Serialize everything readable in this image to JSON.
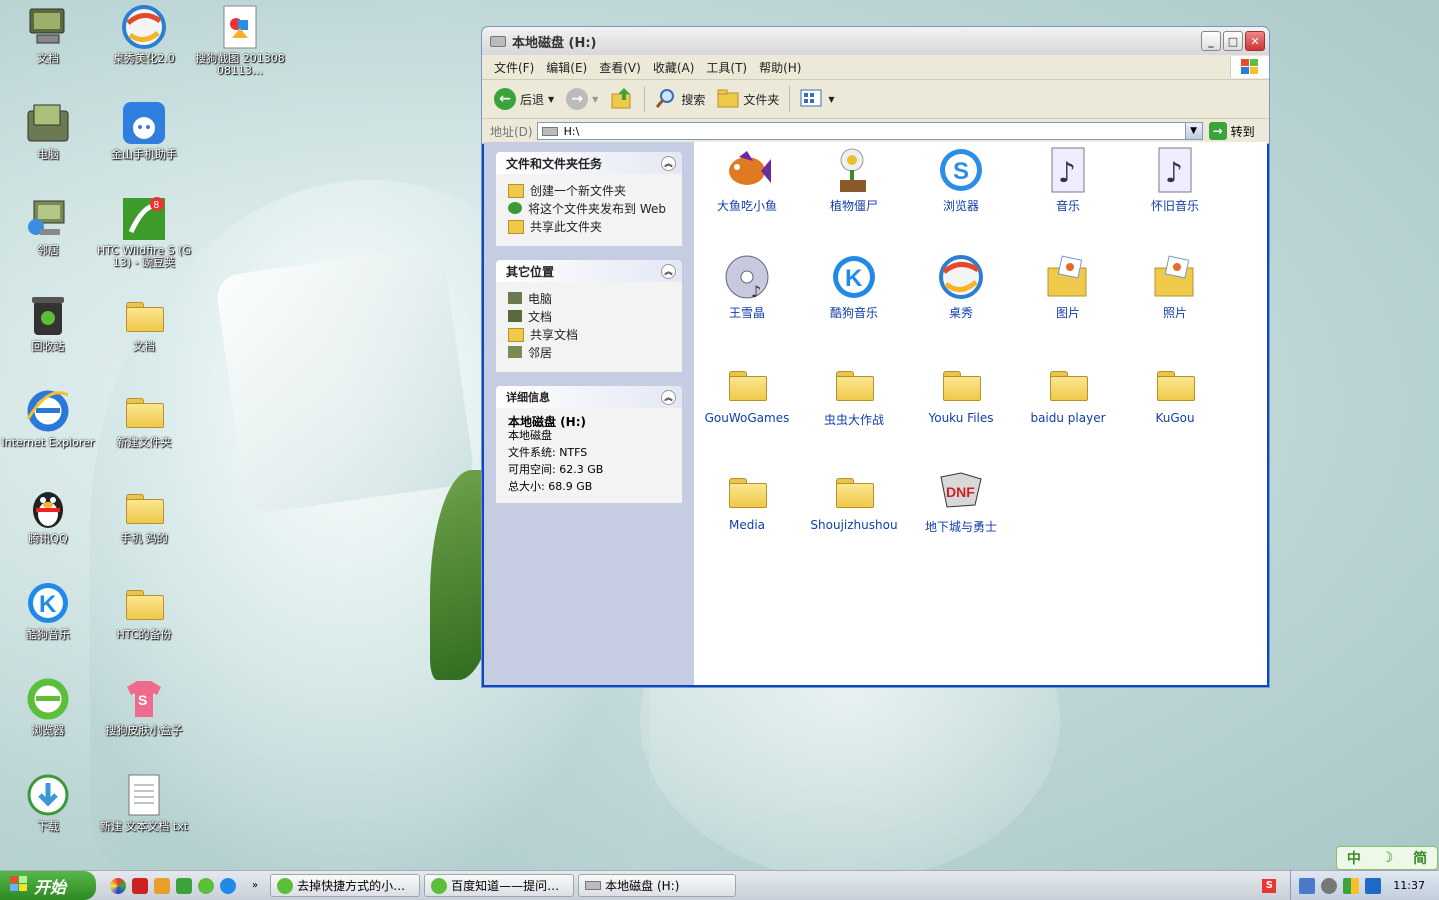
{
  "desktop": {
    "icons": [
      {
        "label": "文档",
        "icon": "computer-icon"
      },
      {
        "label": "桌秀美化2.0",
        "icon": "browser-swirl-icon"
      },
      {
        "label": "搜狗截图 20130808113…",
        "icon": "image-file-icon"
      },
      {
        "label": "电脑",
        "icon": "computer-folder-icon"
      },
      {
        "label": "金山手机助手",
        "icon": "android-helper-icon"
      },
      {
        "label": "邻居",
        "icon": "network-icon"
      },
      {
        "label": "HTC Wildfire S (G13) - 豌豆荚",
        "icon": "wandoujia-icon"
      },
      {
        "label": "回收站",
        "icon": "recycle-bin-icon"
      },
      {
        "label": "文档",
        "icon": "folder-icon"
      },
      {
        "label": "Internet Explorer",
        "icon": "ie-icon"
      },
      {
        "label": "新建文件夹",
        "icon": "folder-icon"
      },
      {
        "label": "腾讯QQ",
        "icon": "qq-icon"
      },
      {
        "label": "手机 妈的",
        "icon": "folder-icon"
      },
      {
        "label": "酷狗音乐",
        "icon": "kugou-icon"
      },
      {
        "label": "HTC的备份",
        "icon": "folder-icon"
      },
      {
        "label": "浏览器",
        "icon": "browser-e-icon"
      },
      {
        "label": "搜狗皮肤小盒子",
        "icon": "sogou-skin-icon"
      },
      {
        "label": "下载",
        "icon": "download-icon"
      },
      {
        "label": "新建 文本文档 txt",
        "icon": "text-document-icon"
      }
    ]
  },
  "window": {
    "title": "本地磁盘 (H:)",
    "menu": [
      "文件(F)",
      "编辑(E)",
      "查看(V)",
      "收藏(A)",
      "工具(T)",
      "帮助(H)"
    ],
    "toolbar": {
      "back": "后退",
      "search": "搜索",
      "folders": "文件夹"
    },
    "address": {
      "label": "地址(D)",
      "value": "H:\\",
      "go": "转到"
    },
    "taskpane": {
      "tasks": {
        "title": "文件和文件夹任务",
        "items": [
          "创建一个新文件夹",
          "将这个文件夹发布到 Web",
          "共享此文件夹"
        ]
      },
      "places": {
        "title": "其它位置",
        "items": [
          "电脑",
          "文档",
          "共享文档",
          "邻居"
        ]
      },
      "details": {
        "title": "详细信息",
        "name": "本地磁盘 (H:)",
        "type": "本地磁盘",
        "fs": "文件系统: NTFS",
        "free": "可用空间: 62.3 GB",
        "total": "总大小: 68.9 GB"
      }
    },
    "files": [
      {
        "label": "大鱼吃小鱼",
        "icon": "fish-icon"
      },
      {
        "label": "植物僵尸",
        "icon": "plant-icon"
      },
      {
        "label": "浏览器",
        "icon": "sogou-browser-icon"
      },
      {
        "label": "音乐",
        "icon": "music-file-icon"
      },
      {
        "label": "怀旧音乐",
        "icon": "music-file-icon"
      },
      {
        "label": "王雪晶",
        "icon": "cd-icon"
      },
      {
        "label": "酷狗音乐",
        "icon": "kugou-icon"
      },
      {
        "label": "桌秀",
        "icon": "browser-swirl-icon"
      },
      {
        "label": "图片",
        "icon": "picture-folder-icon"
      },
      {
        "label": "照片",
        "icon": "picture-folder-icon"
      },
      {
        "label": "GouWoGames",
        "icon": "folder-icon"
      },
      {
        "label": "虫虫大作战",
        "icon": "folder-icon"
      },
      {
        "label": "Youku Files",
        "icon": "folder-icon"
      },
      {
        "label": "baidu player",
        "icon": "folder-icon"
      },
      {
        "label": "KuGou",
        "icon": "folder-icon"
      },
      {
        "label": "Media",
        "icon": "folder-icon"
      },
      {
        "label": "Shoujizhushou",
        "icon": "folder-icon"
      },
      {
        "label": "地下城与勇士",
        "icon": "dnf-game-icon"
      }
    ]
  },
  "taskbar": {
    "start": "开始",
    "tasks": [
      "去掉快捷方式的小…",
      "百度知道——提问…",
      "本地磁盘 (H:)"
    ],
    "clock": "11:37",
    "ime": [
      "中",
      "☽",
      "简"
    ]
  }
}
